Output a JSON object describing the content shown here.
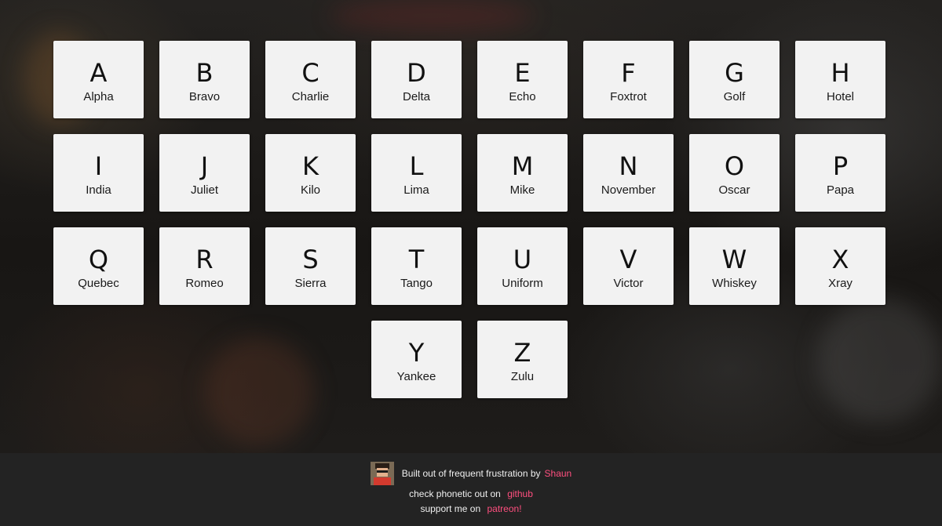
{
  "cards": [
    {
      "letter": "A",
      "word": "Alpha"
    },
    {
      "letter": "B",
      "word": "Bravo"
    },
    {
      "letter": "C",
      "word": "Charlie"
    },
    {
      "letter": "D",
      "word": "Delta"
    },
    {
      "letter": "E",
      "word": "Echo"
    },
    {
      "letter": "F",
      "word": "Foxtrot"
    },
    {
      "letter": "G",
      "word": "Golf"
    },
    {
      "letter": "H",
      "word": "Hotel"
    },
    {
      "letter": "I",
      "word": "India"
    },
    {
      "letter": "J",
      "word": "Juliet"
    },
    {
      "letter": "K",
      "word": "Kilo"
    },
    {
      "letter": "L",
      "word": "Lima"
    },
    {
      "letter": "M",
      "word": "Mike"
    },
    {
      "letter": "N",
      "word": "November"
    },
    {
      "letter": "O",
      "word": "Oscar"
    },
    {
      "letter": "P",
      "word": "Papa"
    },
    {
      "letter": "Q",
      "word": "Quebec"
    },
    {
      "letter": "R",
      "word": "Romeo"
    },
    {
      "letter": "S",
      "word": "Sierra"
    },
    {
      "letter": "T",
      "word": "Tango"
    },
    {
      "letter": "U",
      "word": "Uniform"
    },
    {
      "letter": "V",
      "word": "Victor"
    },
    {
      "letter": "W",
      "word": "Whiskey"
    },
    {
      "letter": "X",
      "word": "Xray"
    },
    {
      "letter": "Y",
      "word": "Yankee"
    },
    {
      "letter": "Z",
      "word": "Zulu"
    }
  ],
  "footer": {
    "built_text": "Built out of frequent frustration by",
    "author_link": "Shaun",
    "github_text": "check phonetic out on",
    "github_link": "github",
    "patreon_text": "support me on",
    "patreon_link": "patreon!",
    "avatar_icon": "pixel-avatar-icon",
    "link_color": "#ff4f7f"
  },
  "colors": {
    "card_bg": "#f2f2f2",
    "footer_bg": "#232323"
  }
}
